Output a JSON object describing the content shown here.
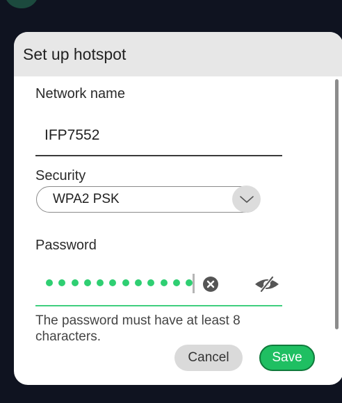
{
  "dialog": {
    "title": "Set up hotspot",
    "network_name_label": "Network name",
    "network_name_value": "IFP7552",
    "security_label": "Security",
    "security_value": "WPA2 PSK",
    "password_label": "Password",
    "password_length": 12,
    "helper_text": "The password must have at least 8 characters.",
    "cancel_label": "Cancel",
    "save_label": "Save"
  },
  "icons": {
    "security_dropdown": "chevron-down-icon",
    "clear_password": "clear-circle-icon",
    "toggle_visibility": "eye-off-icon"
  },
  "colors": {
    "accent": "#1fbf62",
    "password_dots": "#2fcf72",
    "header_bg": "#e7e7e7",
    "backdrop": "#0f1320"
  }
}
